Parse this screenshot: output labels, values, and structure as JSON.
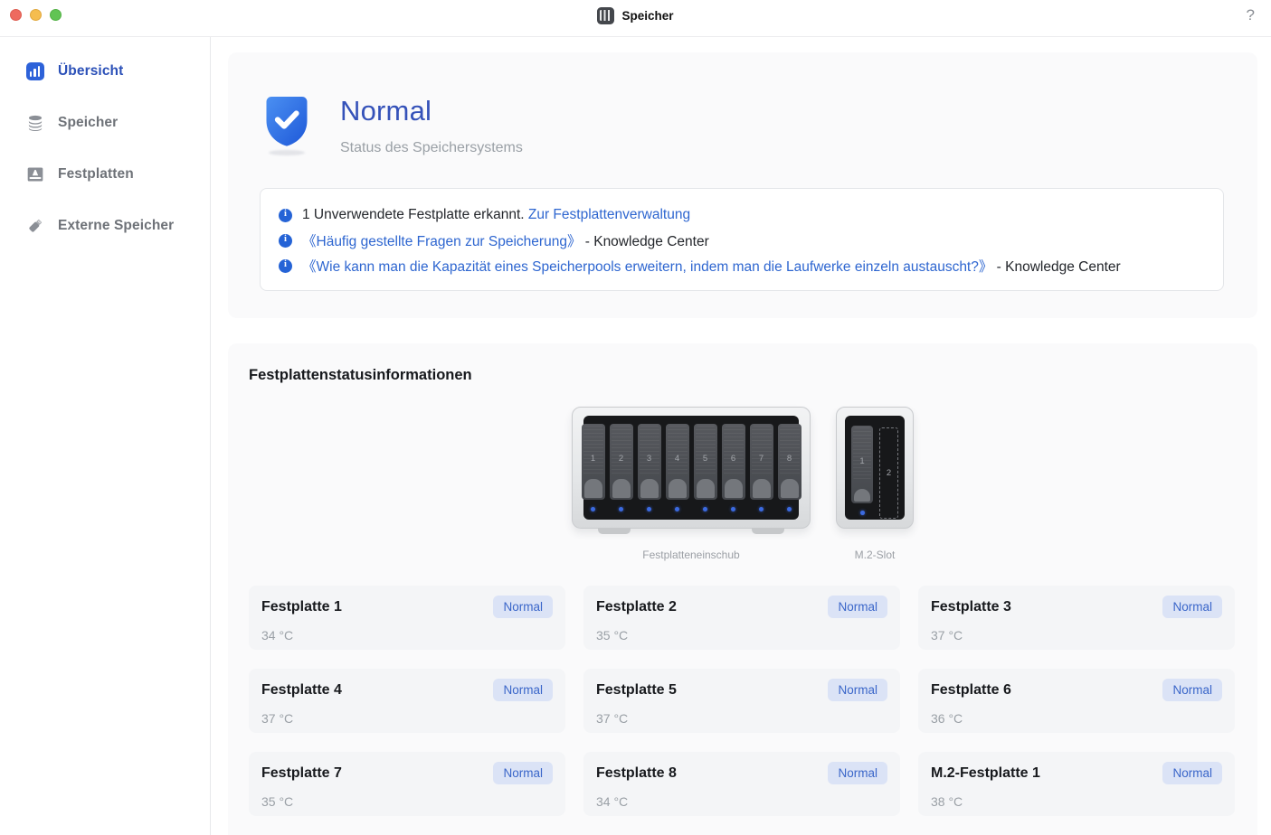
{
  "window": {
    "title": "Speicher",
    "help_label": "?"
  },
  "sidebar": {
    "items": [
      {
        "label": "Übersicht",
        "icon": "bar-chart-icon",
        "active": true
      },
      {
        "label": "Speicher",
        "icon": "storage-stack-icon",
        "active": false
      },
      {
        "label": "Festplatten",
        "icon": "hard-drive-icon",
        "active": false
      },
      {
        "label": "Externe Speicher",
        "icon": "usb-stick-icon",
        "active": false
      }
    ]
  },
  "overview": {
    "status_title": "Normal",
    "status_subtitle": "Status des Speichersystems",
    "status_icon": "shield-check-icon",
    "notices": [
      {
        "pre": "1 Unverwendete Festplatte erkannt. ",
        "link": "Zur Festplattenverwaltung",
        "post": ""
      },
      {
        "pre": "",
        "link": "《Häufig gestellte Fragen zur Speicherung》",
        "post": " - Knowledge Center"
      },
      {
        "pre": "",
        "link": "《Wie kann man die Kapazität eines Speicherpools erweitern, indem man die Laufwerke einzeln austauscht?》",
        "post": " - Knowledge Center"
      }
    ]
  },
  "disk_section": {
    "title": "Festplattenstatusinformationen",
    "enclosure": {
      "label": "Festplatteneinschub",
      "bays": [
        "1",
        "2",
        "3",
        "4",
        "5",
        "6",
        "7",
        "8"
      ]
    },
    "m2": {
      "label": "M.2-Slot",
      "slot_occupied": "1",
      "slot_empty": "2"
    },
    "disks": [
      {
        "name": "Festplatte 1",
        "temp": "34 °C",
        "status": "Normal"
      },
      {
        "name": "Festplatte 2",
        "temp": "35 °C",
        "status": "Normal"
      },
      {
        "name": "Festplatte 3",
        "temp": "37 °C",
        "status": "Normal"
      },
      {
        "name": "Festplatte 4",
        "temp": "37 °C",
        "status": "Normal"
      },
      {
        "name": "Festplatte 5",
        "temp": "37 °C",
        "status": "Normal"
      },
      {
        "name": "Festplatte 6",
        "temp": "36 °C",
        "status": "Normal"
      },
      {
        "name": "Festplatte 7",
        "temp": "35 °C",
        "status": "Normal"
      },
      {
        "name": "Festplatte 8",
        "temp": "34 °C",
        "status": "Normal"
      },
      {
        "name": "M.2-Festplatte 1",
        "temp": "38 °C",
        "status": "Normal"
      }
    ]
  },
  "colors": {
    "accent_blue": "#2d62d9",
    "status_title_blue": "#3552b9",
    "link_blue": "#2e66d0",
    "badge_bg": "#dbe3f6",
    "badge_text": "#3a66c9",
    "led_blue": "#3b6ae0",
    "card_bg": "#fafafb",
    "disk_card_bg": "#f4f5f7",
    "traffic_red": "#ee6a5f",
    "traffic_yellow": "#f5bd4f",
    "traffic_green": "#61c454"
  }
}
